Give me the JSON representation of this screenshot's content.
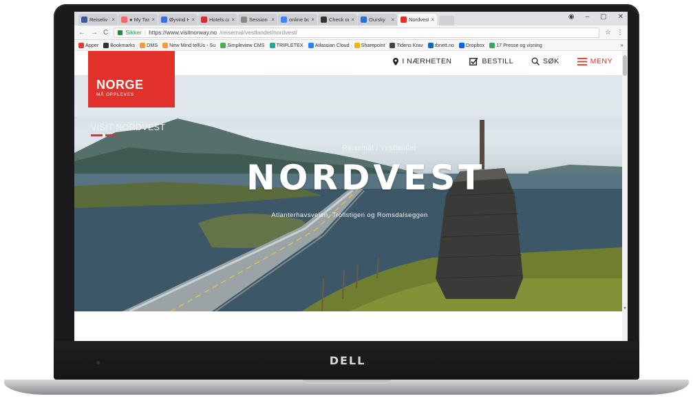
{
  "tabs": [
    {
      "title": "Reiseliv i",
      "color": "#3b5998"
    },
    {
      "title": "● My Tas",
      "color": "#f06a6a"
    },
    {
      "title": "Øyvind H",
      "color": "#3d6fe0"
    },
    {
      "title": "Hotels.co",
      "color": "#d32f2f"
    },
    {
      "title": "Session",
      "color": "#888888"
    },
    {
      "title": "online bo",
      "color": "#4285f4"
    },
    {
      "title": "Check ou",
      "color": "#333333"
    },
    {
      "title": "Oursky",
      "color": "#2f6fd0"
    },
    {
      "title": "Nordvest",
      "color": "#e2312a"
    }
  ],
  "address": {
    "secure_label": "Sikker",
    "url_host": "https://www.visitnorway.no",
    "url_path": "/reisemal/vestlandet/nordvest/"
  },
  "bookmarks": [
    {
      "label": "Apper",
      "color": "#e53935"
    },
    {
      "label": "Bookmarks",
      "color": "#333333"
    },
    {
      "label": "DMS",
      "color": "#f29d38"
    },
    {
      "label": "New Mind tellUs - Su",
      "color": "#f29d38"
    },
    {
      "label": "Simpleview CMS",
      "color": "#4caf50"
    },
    {
      "label": "TRIPLETEX",
      "color": "#26a69a"
    },
    {
      "label": "Atlassian Cloud",
      "color": "#2684ff"
    },
    {
      "label": "Sharepoint",
      "color": "#f4b400"
    },
    {
      "label": "Tidens Krav",
      "color": "#444444"
    },
    {
      "label": "rbnett.no",
      "color": "#1565c0"
    },
    {
      "label": "Dropbox",
      "color": "#0061ff"
    },
    {
      "label": "17 Presse og visning",
      "color": "#34a853"
    }
  ],
  "bookmarks_more": "»",
  "site": {
    "logo_main": "NORGE",
    "logo_sub": "MÅ OPPLEVES",
    "nav": {
      "nearby": "I NÆRHETEN",
      "order": "BESTILL",
      "search": "SØK",
      "menu": "MENY"
    },
    "visit_label": "VISIT NORDVEST",
    "breadcrumb": "Reisemål / Vestlandet",
    "hero_title": "NORDVEST",
    "hero_subtitle": "Atlanterhavsveien, Trollstigen og Romsdalseggen"
  },
  "device_brand": "DELL",
  "colors": {
    "brand_red": "#e2312a"
  }
}
